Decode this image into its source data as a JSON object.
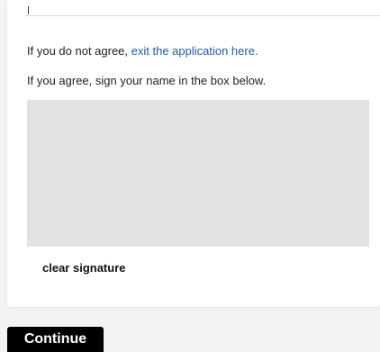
{
  "consent": {
    "disagree_text": "If you do not agree, ",
    "exit_link_label": "exit the application here.",
    "agree_text": "If you agree, sign your name in the box below."
  },
  "signature": {
    "clear_label": "clear signature"
  },
  "actions": {
    "continue_label": "Continue"
  },
  "colors": {
    "link": "#1f5fa8",
    "signature_box": "#e2e2e2",
    "primary_button": "#000000"
  }
}
